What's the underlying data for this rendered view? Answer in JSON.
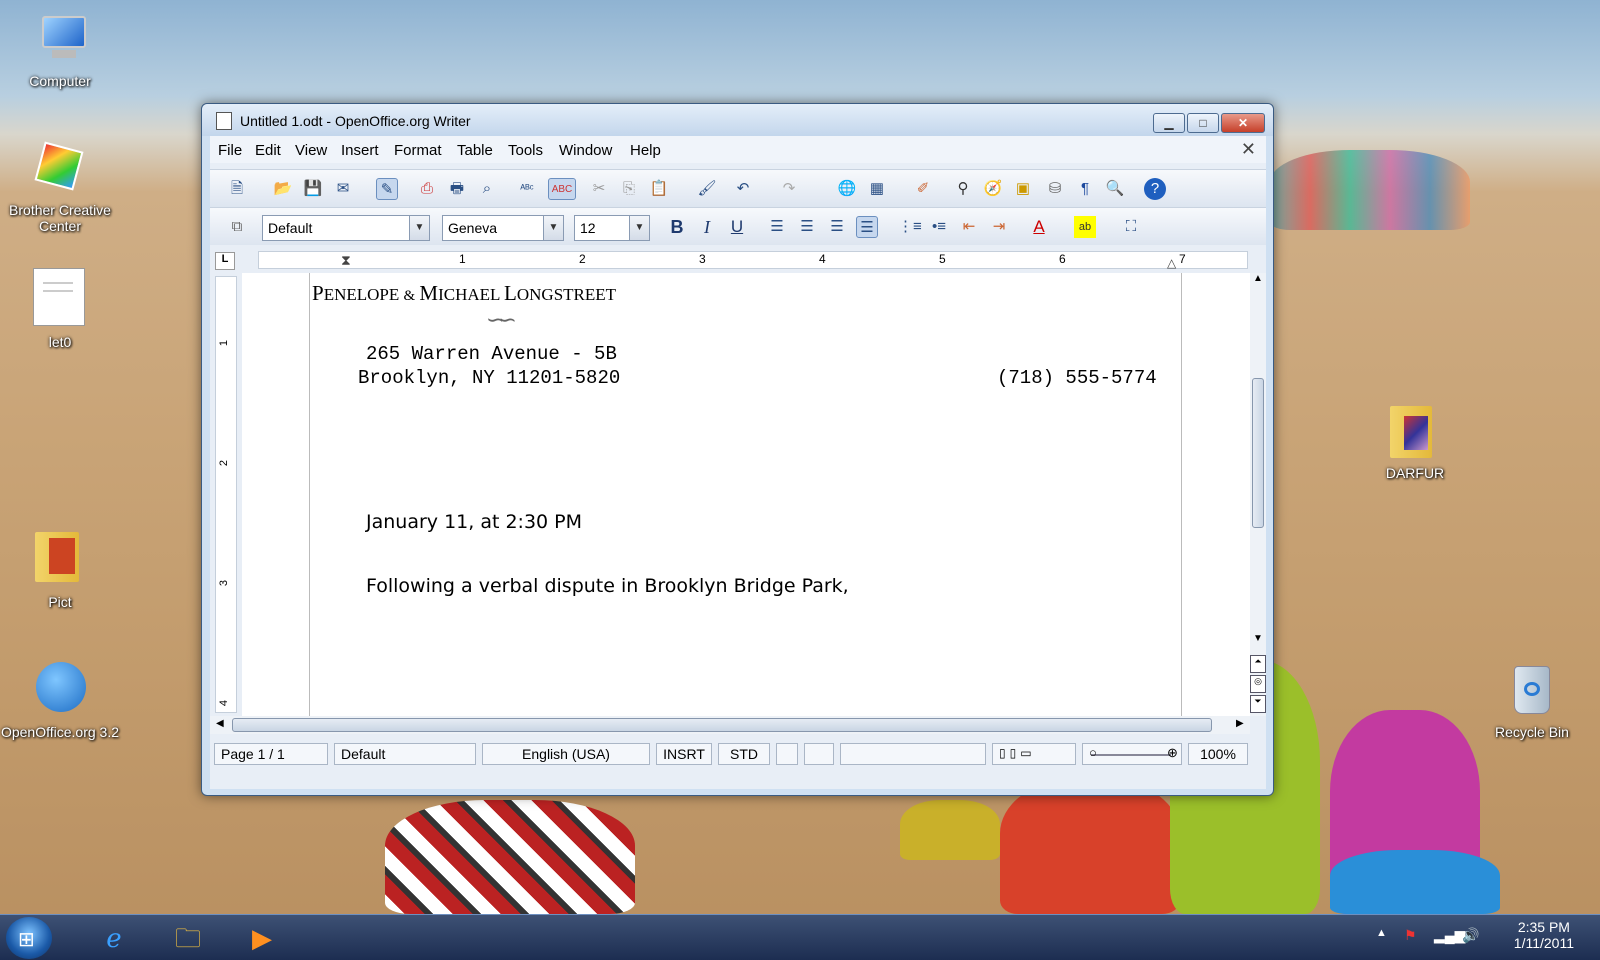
{
  "desktop": {
    "icons": [
      {
        "label": "Computer",
        "icon": "computer-icon"
      },
      {
        "label": "Brother Creative Center",
        "icon": "brother-creative-center-icon"
      },
      {
        "label": "let0",
        "icon": "document-icon"
      },
      {
        "label": "Pict",
        "icon": "folder-icon"
      },
      {
        "label": "OpenOffice.org 3.2",
        "icon": "openoffice-icon"
      },
      {
        "label": "DARFUR",
        "icon": "folder-icon"
      },
      {
        "label": "Recycle Bin",
        "icon": "recycle-bin-icon"
      }
    ]
  },
  "window": {
    "title": "Untitled 1.odt - OpenOffice.org Writer",
    "menu": [
      "File",
      "Edit",
      "View",
      "Insert",
      "Format",
      "Table",
      "Tools",
      "Window",
      "Help"
    ],
    "formatting": {
      "style": "Default",
      "font": "Geneva",
      "size": "12"
    },
    "ruler_numbers": [
      "1",
      "2",
      "3",
      "4",
      "5",
      "6",
      "7"
    ],
    "vruler_numbers": [
      "1",
      "2",
      "3",
      "4"
    ]
  },
  "document": {
    "name": "PENELOPE & MICHAEL LONGSTREET",
    "name_parts": {
      "first": "P",
      "first_rest": "ENELOPE",
      "amp": "&",
      "second": "M",
      "second_rest": "ICHAEL",
      "third": "L",
      "third_rest": "ONGSTREET"
    },
    "ornament": "∽∽",
    "address_line1": "265 Warren Avenue - 5B",
    "address_line2": "Brooklyn, NY 11201-5820",
    "phone": "(718) 555-5774",
    "date_line": "January 11, at 2:30 PM",
    "body_line": "Following a verbal dispute in Brooklyn Bridge Park,"
  },
  "statusbar": {
    "page": "Page 1 / 1",
    "style": "Default",
    "language": "English (USA)",
    "insert_mode": "INSRT",
    "selection_mode": "STD",
    "zoom": "100%"
  },
  "taskbar": {
    "time": "2:35 PM",
    "date": "1/11/2011"
  }
}
